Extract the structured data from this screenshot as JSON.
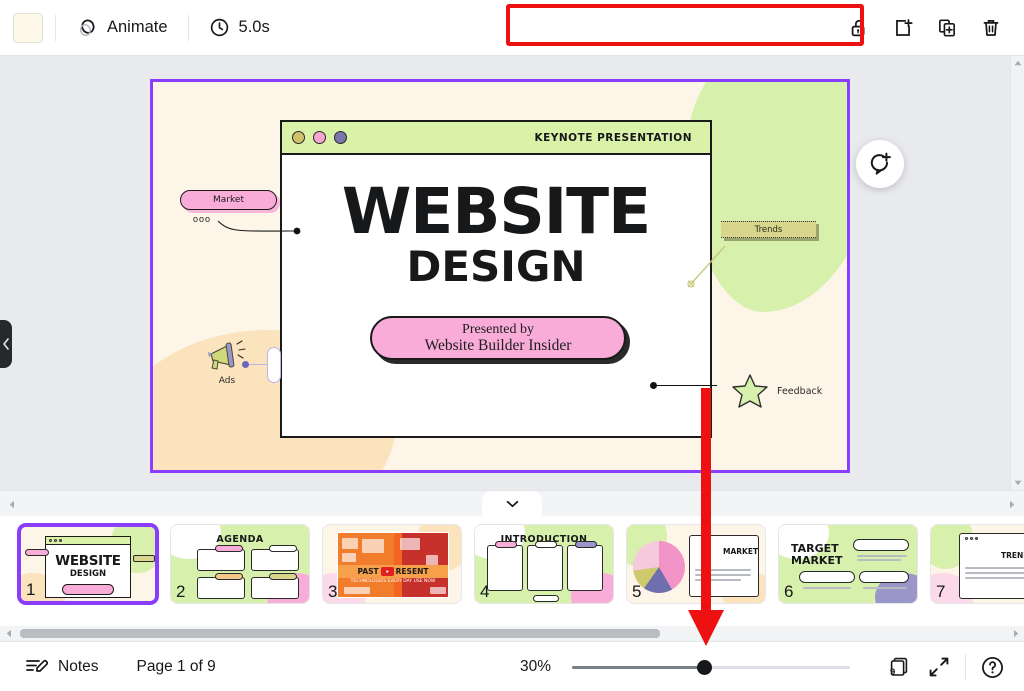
{
  "toolbar": {
    "color_swatch_value": "#fdf8e8",
    "animate_label": "Animate",
    "duration_label": "5.0s",
    "icons": {
      "animate": "animate-icon",
      "timer": "clock-icon",
      "lock": "unlock-icon",
      "add_page": "add-page-icon",
      "duplicate": "duplicate-page-icon",
      "delete": "trash-icon"
    }
  },
  "canvas": {
    "comment_button": "add-comment-icon",
    "left_panel_toggle": "chevron-left-icon",
    "collapse_panel_toggle": "chevron-down-icon",
    "slide": {
      "browser_header_title": "KEYNOTE PRESENTATION",
      "title_line1": "WEBSITE",
      "title_line2": "DESIGN",
      "presented_line1": "Presented by",
      "presented_line2": "Website Builder Insider",
      "tags": {
        "market": "Market",
        "market_dots": "ooo",
        "trends": "Trends",
        "ads": "Ads",
        "feedback": "Feedback"
      },
      "colors": {
        "background_cream": "#fdf6e8",
        "blob_green": "#d7f0ab",
        "blob_peach": "#fae3bd",
        "accent_pink": "#f9acd8",
        "header_green": "#d9f2a8",
        "selection_purple": "#8b3dff",
        "tag_olive": "#d8d68c"
      },
      "browser_dots": [
        "#cfc06a",
        "#f7a6d0",
        "#7b76ab"
      ]
    }
  },
  "thumbnails": [
    {
      "number": "1",
      "title": "WEBSITE DESIGN",
      "selected": true,
      "style": "title"
    },
    {
      "number": "2",
      "title": "AGENDA",
      "selected": false,
      "style": "agenda"
    },
    {
      "number": "3",
      "title": "PAST PRESENT",
      "selected": false,
      "style": "video"
    },
    {
      "number": "4",
      "title": "INTRODUCTION",
      "selected": false,
      "style": "intro"
    },
    {
      "number": "5",
      "title": "MARKET",
      "selected": false,
      "style": "market"
    },
    {
      "number": "6",
      "title": "TARGET MARKET",
      "selected": false,
      "style": "target"
    },
    {
      "number": "7",
      "title": "TRENDS",
      "selected": false,
      "style": "trends"
    }
  ],
  "thumb1": {
    "title": "WEBSITE",
    "subtitle": "DESIGN"
  },
  "thumb3": {
    "band_left": "PAST",
    "band_right": "RESENT",
    "caption": "TECHNOLOGIES EVERY DAY USE NOW"
  },
  "bottombar": {
    "notes_label": "Notes",
    "notes_icon": "notes-pencil-icon",
    "page_indicator": "Page 1 of 9",
    "zoom_percent": "30%",
    "grid_count": "9",
    "grid_icon": "grid-view-icon",
    "fullscreen_icon": "expand-icon",
    "help_icon": "help-icon"
  }
}
